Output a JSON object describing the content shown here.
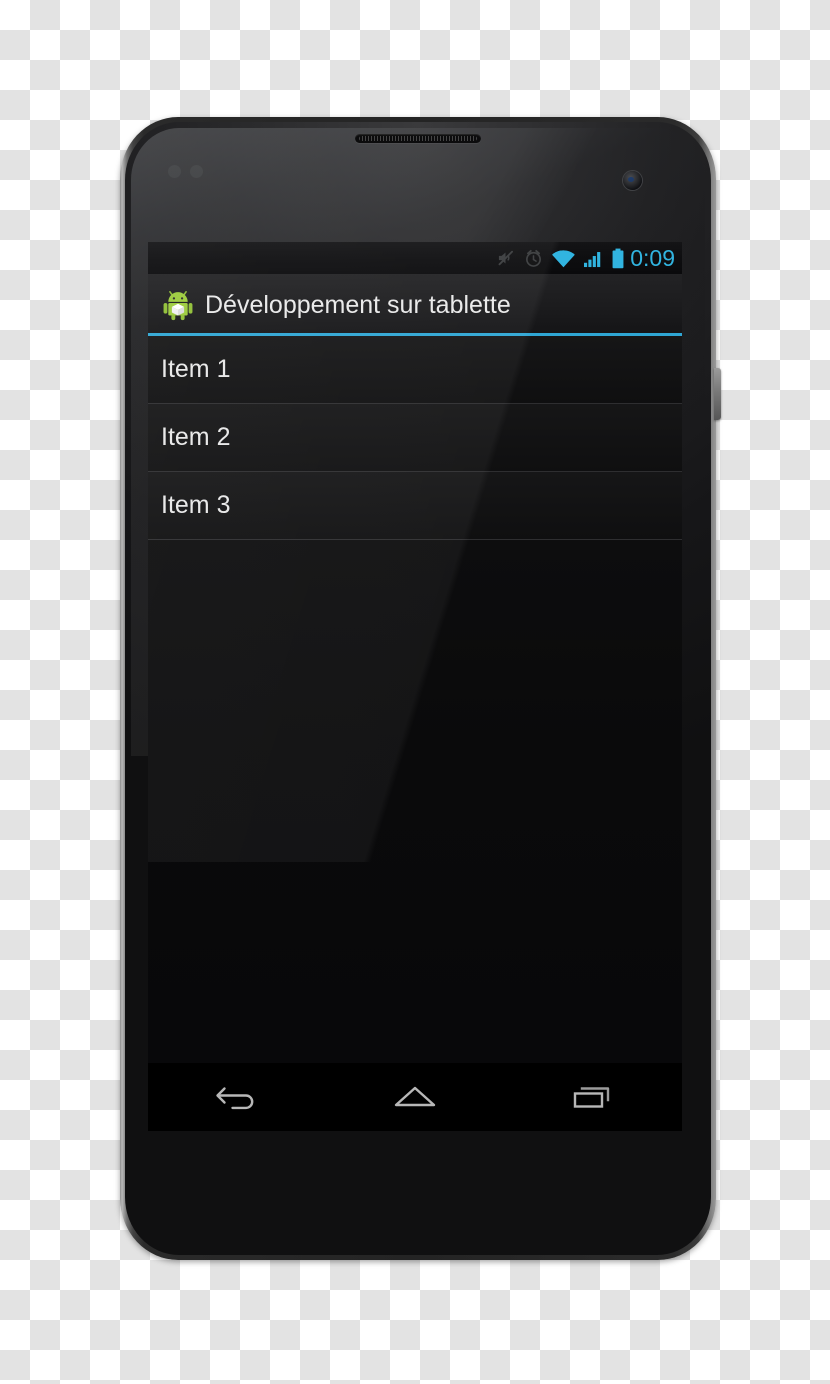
{
  "device": {
    "name": "android-smartphone",
    "hardware": {
      "earpiece": "earpiece-speaker",
      "front_camera": "front-camera",
      "proximity_sensor": "proximity-sensor",
      "power_button": "power-button"
    }
  },
  "status_bar": {
    "icons": [
      {
        "name": "mute-icon",
        "label": "Silencieux"
      },
      {
        "name": "alarm-clock-icon",
        "label": "Alarme"
      },
      {
        "name": "wifi-icon",
        "label": "Wi-Fi"
      },
      {
        "name": "cellular-signal-icon",
        "label": "Signal"
      },
      {
        "name": "battery-full-icon",
        "label": "Batterie"
      }
    ],
    "clock": "0:09",
    "accent_color": "#31b4e0"
  },
  "action_bar": {
    "app_icon": "android-app-icon",
    "title": "Développement sur tablette",
    "underline_color": "#2fa6d4"
  },
  "list": {
    "items": [
      {
        "label": "Item 1"
      },
      {
        "label": "Item 2"
      },
      {
        "label": "Item 3"
      }
    ]
  },
  "nav_bar": {
    "buttons": [
      {
        "name": "back-button",
        "label": "Retour"
      },
      {
        "name": "home-button",
        "label": "Accueil"
      },
      {
        "name": "recents-button",
        "label": "Applications récentes"
      }
    ]
  }
}
